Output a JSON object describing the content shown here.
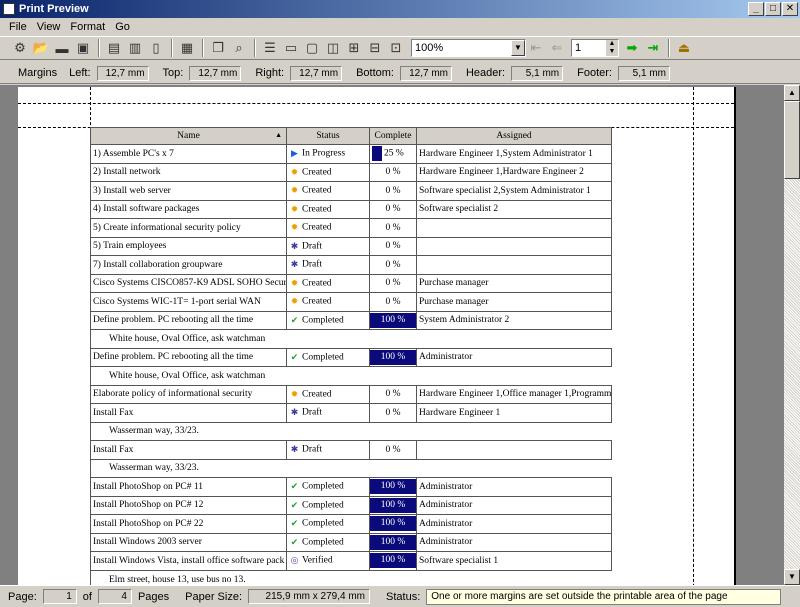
{
  "window": {
    "title": "Print Preview"
  },
  "menu": [
    "File",
    "View",
    "Format",
    "Go"
  ],
  "toolbar": {
    "zoom": "100%",
    "page": "1"
  },
  "margins": {
    "label": "Margins",
    "left_label": "Left:",
    "left": "12,7 mm",
    "top_label": "Top:",
    "top": "12,7 mm",
    "right_label": "Right:",
    "right": "12,7 mm",
    "bottom_label": "Bottom:",
    "bottom": "12,7 mm",
    "header_label": "Header:",
    "header": "5,1 mm",
    "footer_label": "Footer:",
    "footer": "5,1 mm"
  },
  "table": {
    "headers": {
      "name": "Name",
      "status": "Status",
      "complete": "Complete",
      "assigned": "Assigned"
    },
    "rows": [
      {
        "name": "1) Assemble PC's x 7",
        "status": "In Progress",
        "icon": "in-progress-icon",
        "complete": "25 %",
        "assigned": "Hardware Engineer 1,System Administrator 1"
      },
      {
        "name": "2) Install network",
        "status": "Created",
        "icon": "created-icon",
        "complete": "0 %",
        "assigned": "Hardware Engineer 1,Hardware Engineer 2"
      },
      {
        "name": "3) Install web server",
        "status": "Created",
        "icon": "created-icon",
        "complete": "0 %",
        "assigned": "Software specialist 2,System Administrator 1"
      },
      {
        "name": "4) Install software packages",
        "status": "Created",
        "icon": "created-icon",
        "complete": "0 %",
        "assigned": "Software specialist 2"
      },
      {
        "name": "5) Create informational security policy",
        "status": "Created",
        "icon": "created-icon",
        "complete": "0 %",
        "assigned": ""
      },
      {
        "name": "5) Train employees",
        "status": "Draft",
        "icon": "draft-icon",
        "complete": "0 %",
        "assigned": ""
      },
      {
        "name": "7) Install collaboration groupware",
        "status": "Draft",
        "icon": "draft-icon",
        "complete": "0 %",
        "assigned": ""
      },
      {
        "name": "Cisco Systems CISCO857-K9 ADSL SOHO Securi",
        "status": "Created",
        "icon": "created-icon",
        "complete": "0 %",
        "assigned": "Purchase manager"
      },
      {
        "name": "Cisco Systems WIC-1T= 1-port serial WAN",
        "status": "Created",
        "icon": "created-icon",
        "complete": "0 %",
        "assigned": "Purchase manager"
      },
      {
        "name": "Define problem. PC rebooting all the time",
        "status": "Completed",
        "icon": "completed-icon",
        "complete": "100 %",
        "assigned": "System Administrator 2"
      },
      {
        "note": "White house, Oval Office, ask watchman"
      },
      {
        "name": "Define problem. PC rebooting all the time",
        "status": "Completed",
        "icon": "completed-icon",
        "complete": "100 %",
        "assigned": "Administrator"
      },
      {
        "note": "White house, Oval Office, ask watchman"
      },
      {
        "name": "Elaborate policy of informational security",
        "status": "Created",
        "icon": "created-icon",
        "complete": "0 %",
        "assigned": "Hardware Engineer 1,Office manager 1,Programm"
      },
      {
        "name": "Install Fax",
        "status": "Draft",
        "icon": "draft-icon",
        "complete": "0 %",
        "assigned": "Hardware Engineer 1"
      },
      {
        "note": "Wasserman way, 33/23."
      },
      {
        "name": "Install Fax",
        "status": "Draft",
        "icon": "draft-icon",
        "complete": "0 %",
        "assigned": ""
      },
      {
        "note": "Wasserman way, 33/23."
      },
      {
        "name": "Install PhotoShop on PC# 11",
        "status": "Completed",
        "icon": "completed-icon",
        "complete": "100 %",
        "assigned": "Administrator"
      },
      {
        "name": "Install PhotoShop on PC# 12",
        "status": "Completed",
        "icon": "completed-icon",
        "complete": "100 %",
        "assigned": "Administrator"
      },
      {
        "name": "Install PhotoShop on PC# 22",
        "status": "Completed",
        "icon": "completed-icon",
        "complete": "100 %",
        "assigned": "Administrator"
      },
      {
        "name": "Install Windows 2003 server",
        "status": "Completed",
        "icon": "completed-icon",
        "complete": "100 %",
        "assigned": "Administrator"
      },
      {
        "name": "Install Windows Vista, install office software pack",
        "status": "Verified",
        "icon": "verified-icon",
        "complete": "100 %",
        "assigned": "Software specialist 1"
      },
      {
        "note": "Elm street, house 13, use bus no 13."
      }
    ]
  },
  "statusbar": {
    "page_label": "Page:",
    "page": "1",
    "of_label": "of",
    "pages": "4",
    "pages_label": "Pages",
    "paper_label": "Paper Size:",
    "paper": "215,9 mm x 279,4 mm",
    "status_label": "Status:",
    "status_msg": "One or more margins are set outside the printable area of the page"
  }
}
